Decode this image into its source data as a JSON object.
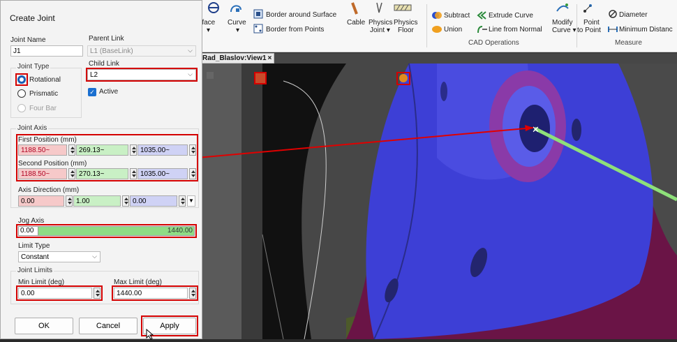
{
  "dialog": {
    "title": "Create Joint",
    "joint_name_label": "Joint Name",
    "joint_name_value": "J1",
    "parent_link_label": "Parent Link",
    "parent_link_value": "L1 (BaseLink)",
    "child_link_label": "Child Link",
    "child_link_value": "L2",
    "active_label": "Active",
    "joint_type_label": "Joint Type",
    "joint_types": [
      "Rotational",
      "Prismatic",
      "Four Bar"
    ],
    "joint_axis_label": "Joint Axis",
    "first_position_label": "First Position (mm)",
    "first_position": [
      "1188.50~",
      "269.13~",
      "1035.00~"
    ],
    "second_position_label": "Second Position (mm)",
    "second_position": [
      "1188.50~",
      "270.13~",
      "1035.00~"
    ],
    "axis_direction_label": "Axis Direction (mm)",
    "axis_direction": [
      "0.00",
      "1.00",
      "0.00"
    ],
    "jog_axis_label": "Jog Axis",
    "jog_min": "0.00",
    "jog_max": "1440.00",
    "limit_type_label": "Limit Type",
    "limit_type_value": "Constant",
    "joint_limits_label": "Joint Limits",
    "min_limit_label": "Min Limit (deg)",
    "min_limit_value": "0.00",
    "max_limit_label": "Max Limit (deg)",
    "max_limit_value": "1440.00",
    "ok": "OK",
    "cancel": "Cancel",
    "apply": "Apply"
  },
  "ribbon": {
    "surface_label": "rface",
    "curve_label": "Curve",
    "border_around_surface": "Border around Surface",
    "border_from_points": "Border from Points",
    "cable": "Cable",
    "physics_joint": [
      "Physics",
      "Joint ▾"
    ],
    "physics_floor": [
      "Physics",
      "Floor"
    ],
    "subtract": "Subtract",
    "union": "Union",
    "extrude_curve": "Extrude Curve",
    "line_from_normal": "Line from Normal",
    "modify_curve": [
      "Modify",
      "Curve ▾"
    ],
    "cad_operations": "CAD Operations",
    "point_to_point": [
      "Point",
      "to Point"
    ],
    "diameter": "Diameter",
    "minimum_distance": "Minimum Distanc",
    "measure": "Measure"
  },
  "viewport": {
    "tab_title": "Rad_Blaslov:View1",
    "tab_close": "×"
  },
  "colors": {
    "highlight": "#d40000",
    "field_pink": "#f6c9c9",
    "field_green": "#c9f0c5",
    "field_blue": "#cfd2f5",
    "part_blue": "#3d3fd6",
    "part_magenta": "#7b1450",
    "axis_line": "#8ee07a"
  }
}
